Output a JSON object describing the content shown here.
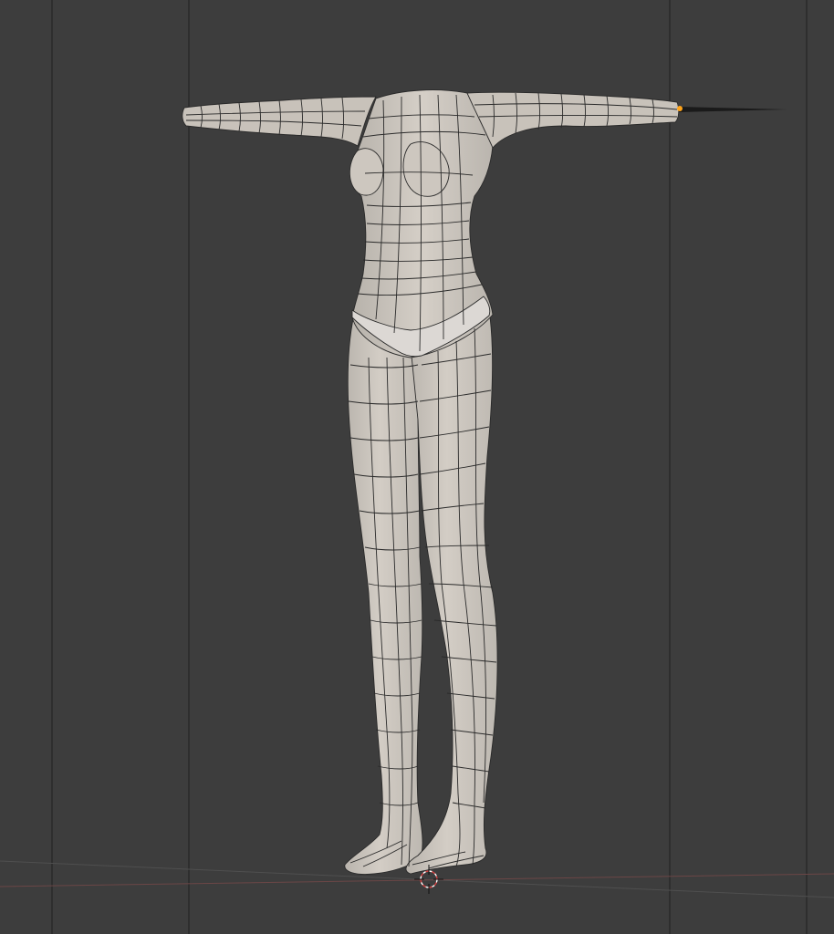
{
  "viewport": {
    "background_color": "#3d3d3d",
    "grid_line_color": "#1e1e1e",
    "mesh_fill_color": "#cfc9c1",
    "mesh_shadow_color": "#a9a49d",
    "mesh_wire_color": "#2a2a2a",
    "selected_vertex_color": "#ffa41a",
    "x_axis_color": "#7a4a4a",
    "y_axis_color": "#5c6b3c",
    "cursor_color": "#d44040",
    "icons": [
      "3d-cursor-icon",
      "mesh-model-icon",
      "ik-bone-icon"
    ]
  }
}
